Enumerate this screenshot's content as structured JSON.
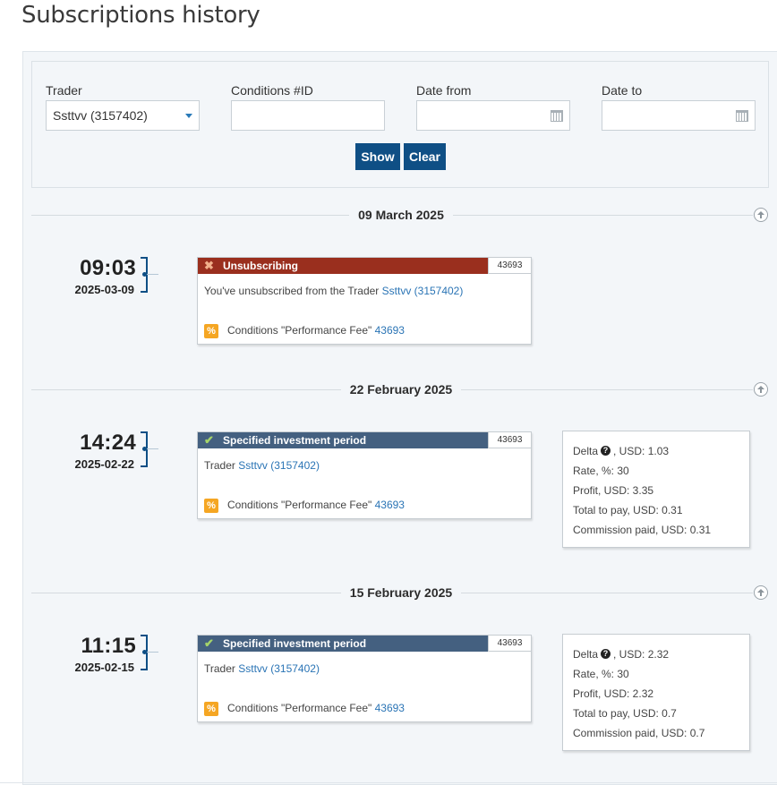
{
  "page": {
    "title": "Subscriptions history"
  },
  "filters": {
    "trader_label": "Trader",
    "trader_value": "Ssttvv (3157402)",
    "conditions_label": "Conditions #ID",
    "conditions_value": "",
    "date_from_label": "Date from",
    "date_from_value": "",
    "date_to_label": "Date to",
    "date_to_value": "",
    "show_label": "Show",
    "clear_label": "Clear"
  },
  "groups": [
    {
      "date_heading": "09 March 2025",
      "time": "09:03",
      "date": "2025-03-09",
      "card": {
        "status": "error",
        "icon": "x-icon",
        "title": "Unsubscribing",
        "id": "43693",
        "line_prefix": "You've unsubscribed from the Trader ",
        "trader_link": "Ssttvv (3157402)",
        "conditions_text": "Conditions \"Performance Fee\" ",
        "conditions_link": "43693"
      }
    },
    {
      "date_heading": "22 February 2025",
      "time": "14:24",
      "date": "2025-02-22",
      "card": {
        "status": "ok",
        "icon": "check-icon",
        "title": "Specified investment period",
        "id": "43693",
        "line_prefix": "Trader ",
        "trader_link": "Ssttvv (3157402)",
        "conditions_text": "Conditions \"Performance Fee\" ",
        "conditions_link": "43693"
      },
      "stats": {
        "delta_label": "Delta",
        "delta_value": ", USD: 1.03",
        "rate": "Rate, %: 30",
        "profit": "Profit, USD: 3.35",
        "total": "Total to pay, USD: 0.31",
        "commission": "Commission paid, USD: 0.31"
      }
    },
    {
      "date_heading": "15 February 2025",
      "time": "11:15",
      "date": "2025-02-15",
      "card": {
        "status": "ok",
        "icon": "check-icon",
        "title": "Specified investment period",
        "id": "43693",
        "line_prefix": "Trader ",
        "trader_link": "Ssttvv (3157402)",
        "conditions_text": "Conditions \"Performance Fee\" ",
        "conditions_link": "43693"
      },
      "stats": {
        "delta_label": "Delta",
        "delta_value": ", USD: 2.32",
        "rate": "Rate, %: 30",
        "profit": "Profit, USD: 2.32",
        "total": "Total to pay, USD: 0.7",
        "commission": "Commission paid, USD: 0.7"
      }
    }
  ],
  "icons": {
    "percent_badge": "%",
    "help_badge": "?"
  },
  "colors": {
    "primary": "#0f4f85",
    "error_header": "#9a2f1e",
    "ok_header": "#446080",
    "link": "#2a74b5",
    "badge": "#f5a623"
  }
}
